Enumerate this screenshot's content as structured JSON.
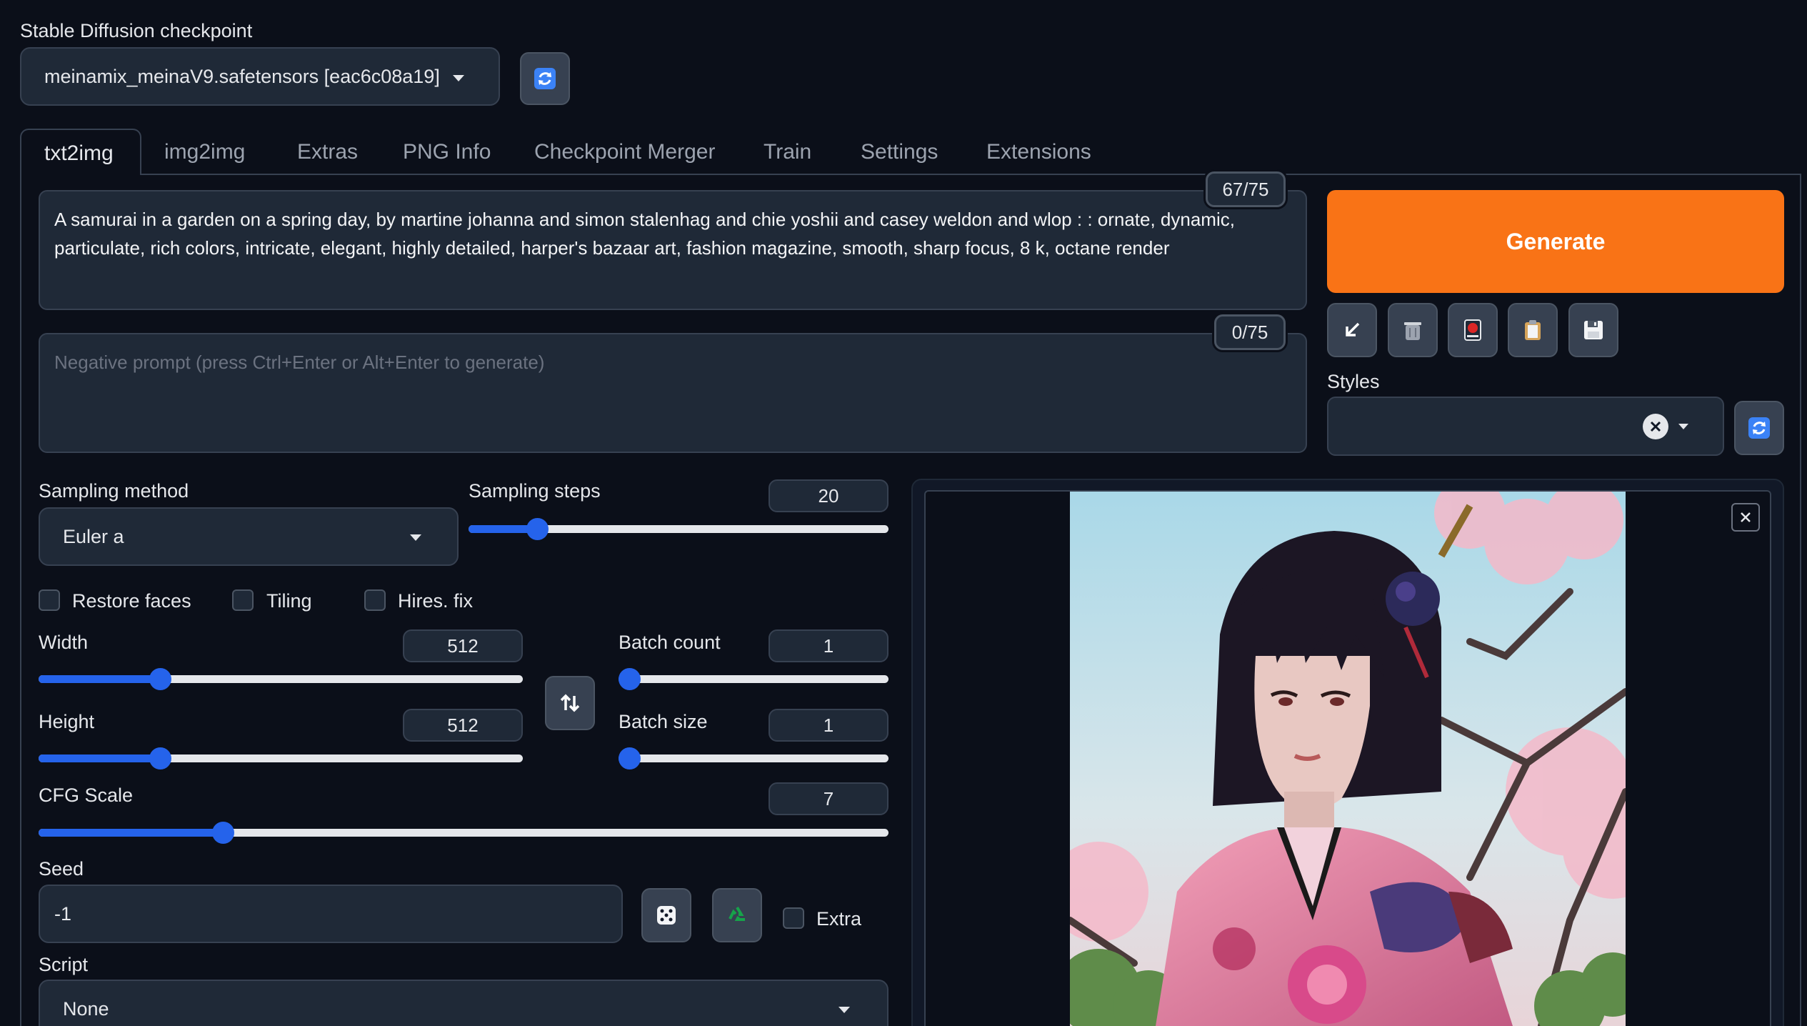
{
  "checkpoint": {
    "label": "Stable Diffusion checkpoint",
    "value": "meinamix_meinaV9.safetensors [eac6c08a19]"
  },
  "tabs": [
    "txt2img",
    "img2img",
    "Extras",
    "PNG Info",
    "Checkpoint Merger",
    "Train",
    "Settings",
    "Extensions"
  ],
  "prompt": {
    "text_line1": "A samurai in a garden on a spring day, by martine johanna and simon stalenhag and chie yoshii and casey weldon and wlop : : ornate, dynamic,",
    "text_line2": "particulate, rich colors, intricate, elegant, highly detailed, harper's bazaar art, fashion magazine, smooth, sharp focus, 8 k, octane render",
    "counter": "67/75"
  },
  "negative_prompt": {
    "placeholder": "Negative prompt (press Ctrl+Enter or Alt+Enter to generate)",
    "counter": "0/75"
  },
  "generate_label": "Generate",
  "styles_label": "Styles",
  "sampling": {
    "method_label": "Sampling method",
    "method_value": "Euler a",
    "steps_label": "Sampling steps",
    "steps_value": "20",
    "steps_fraction": 0.146
  },
  "checkboxes": {
    "restore_faces": "Restore faces",
    "tiling": "Tiling",
    "hires_fix": "Hires. fix"
  },
  "width": {
    "label": "Width",
    "value": "512",
    "fraction": 0.24
  },
  "height": {
    "label": "Height",
    "value": "512",
    "fraction": 0.24
  },
  "batch_count": {
    "label": "Batch count",
    "value": "1",
    "fraction": 0.0
  },
  "batch_size": {
    "label": "Batch size",
    "value": "1",
    "fraction": 0.0
  },
  "cfg": {
    "label": "CFG Scale",
    "value": "7",
    "fraction": 0.21
  },
  "seed": {
    "label": "Seed",
    "value": "-1",
    "extra_label": "Extra"
  },
  "script": {
    "label": "Script",
    "value": "None"
  },
  "colors": {
    "generate": "#f97316",
    "accent": "#2563eb",
    "background": "#0b0f19"
  }
}
